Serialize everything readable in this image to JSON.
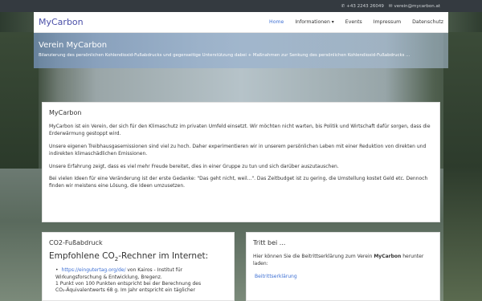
{
  "topbar": {
    "phone": "+43 2243 26049",
    "email": "verein@mycarbon.at",
    "phone_icon": "phone-icon",
    "email_icon": "envelope-icon"
  },
  "navbar": {
    "brand": "MyCarbon",
    "items": [
      {
        "label": "Home",
        "active": true
      },
      {
        "label": "Informationen",
        "dropdown": true
      },
      {
        "label": "Events"
      },
      {
        "label": "Impressum"
      },
      {
        "label": "Datenschutz"
      }
    ]
  },
  "hero": {
    "title": "Verein MyCarbon",
    "subtitle": "Bilanzierung des persönlichen Kohlendioxid-Fußabdrucks und gegenseitige Unterstützung dabei + Maßnahmen zur Senkung des persönlichen Kohlendioxid-Fußabdrucks ..."
  },
  "main": {
    "title": "MyCarbon",
    "paragraphs": [
      "MyCarbon ist ein Verein, der sich für den Klimaschutz im privaten Umfeld einsetzt. Wir möchten nicht warten, bis Politik und Wirtschaft dafür sorgen, dass die Erderwärmung gestoppt wird.",
      "Unsere eigenen Treibhausgasemissionen sind viel zu hoch. Daher experimentieren wir in unserem persönlichen Leben mit einer Reduktion von direkten und indirekten klimaschädlichen Emissionen.",
      "Unsere Erfahrung zeigt, dass es viel mehr Freude bereitet, dies in einer Gruppe zu tun und sich darüber auszutauschen.",
      "Bei vielen Ideen für eine Veränderung ist der erste Gedanke: \"Das geht nicht, weil...\". Das Zeitbudget ist zu gering, die Umstellung kostet Geld etc. Dennoch finden wir meistens eine Lösung, die Ideen umzusetzen."
    ]
  },
  "co2": {
    "title": "CO2-Fußabdruck",
    "heading_pre": "Empfohlene CO",
    "heading_sub": "2",
    "heading_post": "-Rechner im Internet:",
    "link": "https://eingutertag.org/de/",
    "link_rest": " von Kairos - Institut für Wirkungsforschung & Entwicklung, Bregenz.",
    "line2": "1 Punkt von 100 Punkten entspricht bei der Berechnung des",
    "line3": "CO₂-Äquivalentwerts 68 g. Im Jahr entspricht ein täglicher"
  },
  "join": {
    "title": "Tritt bei ...",
    "text_pre": "Hier können Sie die Beitrittserklärung zum Verein ",
    "text_bold": "MyCarbon",
    "text_post": " herunter laden:",
    "link": "Beitrittserklärung"
  }
}
